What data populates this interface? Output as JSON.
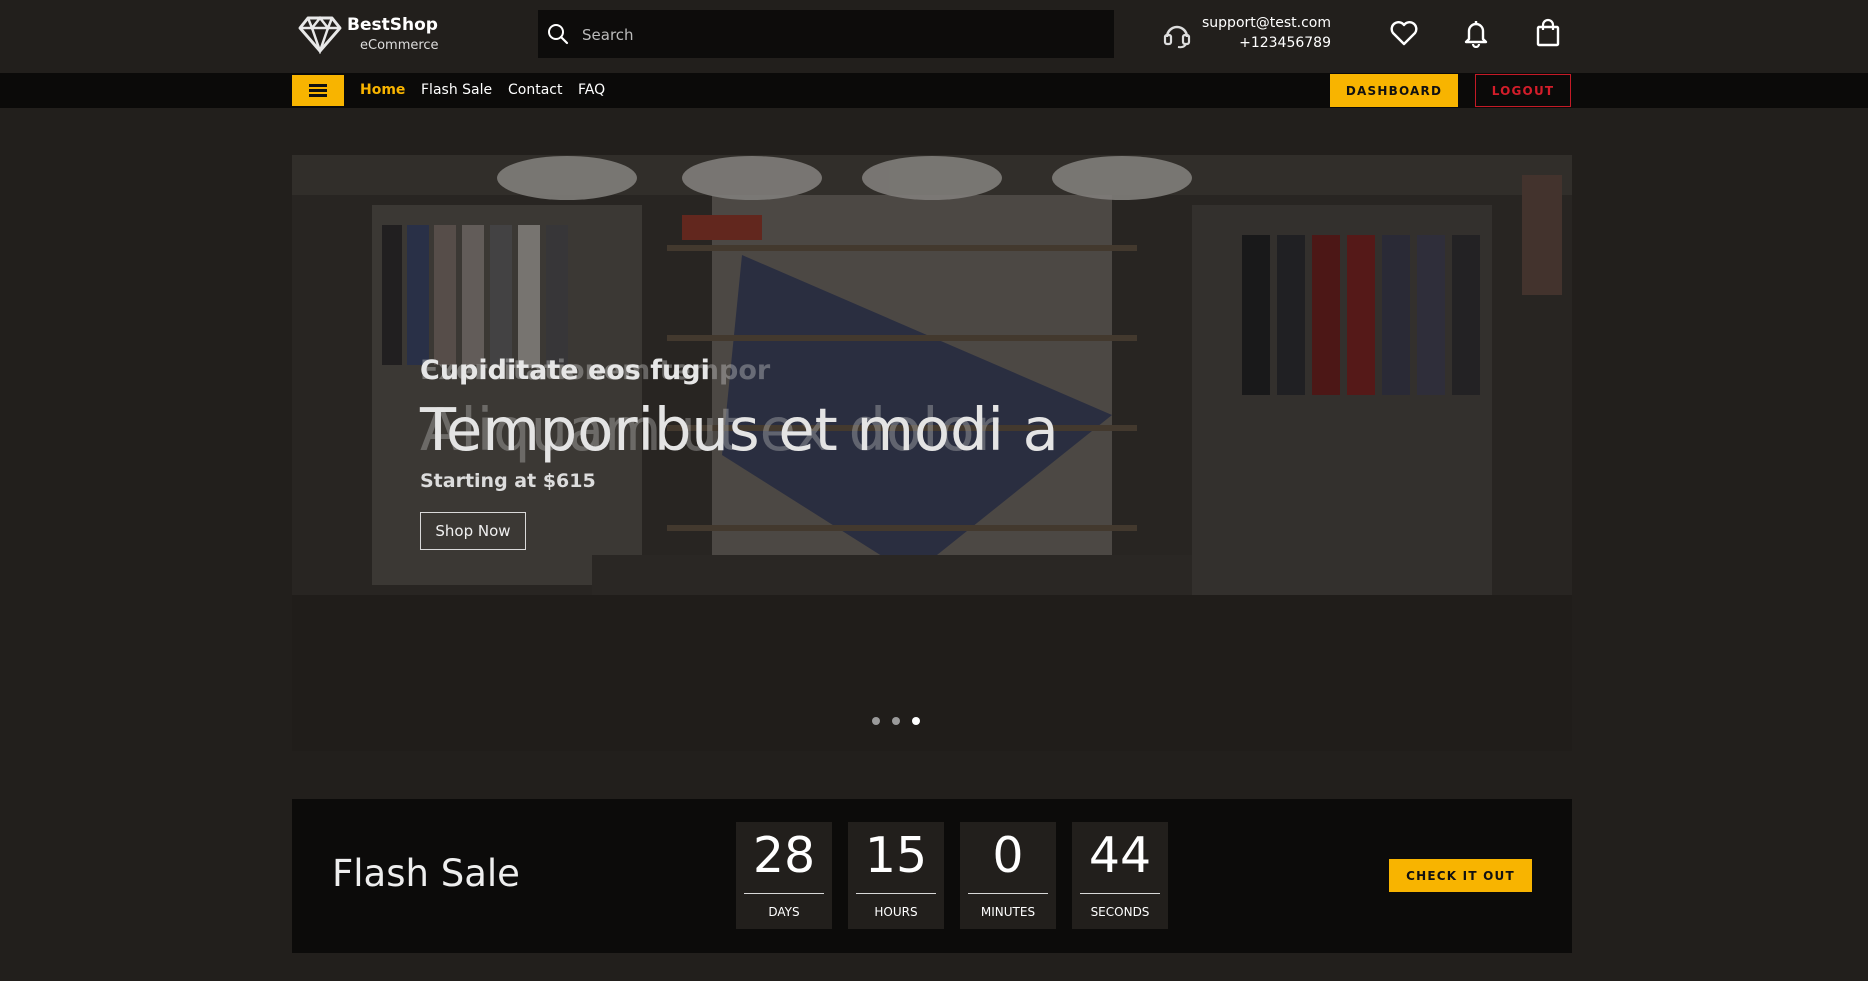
{
  "brand": {
    "name": "BestShop",
    "tagline": "eCommerce",
    "logo_icon": "diamond-icon"
  },
  "search": {
    "placeholder": "Search",
    "value": ""
  },
  "support": {
    "email": "support@test.com",
    "phone": "+123456789",
    "icon": "headset-icon"
  },
  "header_icons": [
    "heart-icon",
    "bell-icon",
    "shopping-bag-icon"
  ],
  "nav": {
    "menu_icon": "hamburger-menu-icon",
    "links": [
      {
        "label": "Home",
        "active": true
      },
      {
        "label": "Flash Sale",
        "active": false
      },
      {
        "label": "Contact",
        "active": false
      },
      {
        "label": "FAQ",
        "active": false
      }
    ],
    "dashboard_label": "DASHBOARD",
    "logout_label": "LOGOUT"
  },
  "hero": {
    "ghost_subtitle": "Exercitationem tempor",
    "subtitle": "Cupiditate eos fugi",
    "ghost_title": "Aliquam ut ex dolor",
    "title": "Temporibus et modi a",
    "price": "Starting at $615",
    "button": "Shop Now",
    "slides_count": 3,
    "active_slide": 3
  },
  "flash_sale": {
    "label": "Flash Sale",
    "countdown": [
      {
        "value": "28",
        "unit": "DAYS"
      },
      {
        "value": "15",
        "unit": "HOURS"
      },
      {
        "value": "0",
        "unit": "MINUTES"
      },
      {
        "value": "44",
        "unit": "SECONDS"
      }
    ],
    "button": "CHECK IT OUT"
  },
  "colors": {
    "accent": "#f8b400",
    "danger": "#d31d2a",
    "background": "#221f1c",
    "bar": "#0b0a09"
  }
}
